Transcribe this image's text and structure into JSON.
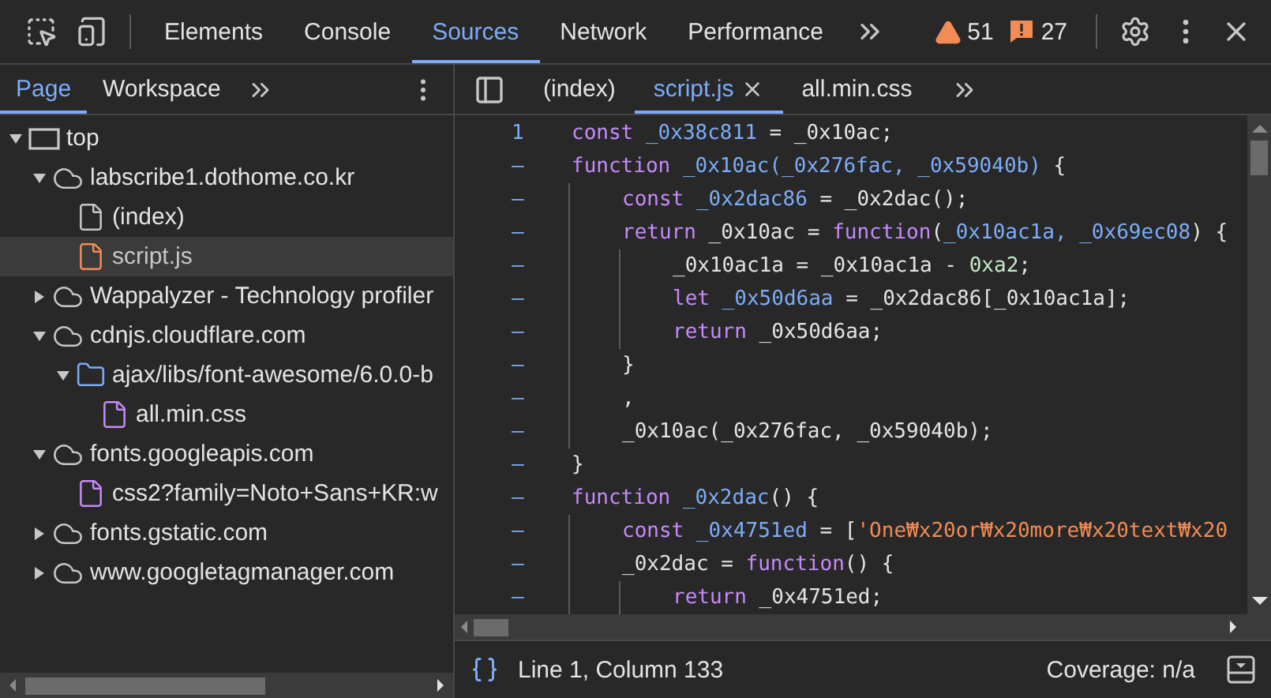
{
  "toolbar": {
    "tabs": [
      {
        "label": "Elements",
        "selected": false
      },
      {
        "label": "Console",
        "selected": false
      },
      {
        "label": "Sources",
        "selected": true
      },
      {
        "label": "Network",
        "selected": false
      },
      {
        "label": "Performance",
        "selected": false
      }
    ],
    "warnings": "51",
    "errors": "27"
  },
  "navigator": {
    "tabs": [
      {
        "label": "Page",
        "selected": true
      },
      {
        "label": "Workspace",
        "selected": false
      }
    ],
    "tree": [
      {
        "kind": "frame",
        "label": "top",
        "expanded": true,
        "selected": false,
        "children": [
          {
            "kind": "domain",
            "label": "labscribe1.dothome.co.kr",
            "expanded": true,
            "selected": false,
            "children": [
              {
                "kind": "file",
                "label": "(index)",
                "color": "#c4c7c5",
                "selected": false
              },
              {
                "kind": "file",
                "label": "script.js",
                "color": "#f28b54",
                "selected": true
              }
            ]
          },
          {
            "kind": "domain",
            "label": "Wappalyzer - Technology profiler",
            "expanded": false,
            "selected": false
          },
          {
            "kind": "domain",
            "label": "cdnjs.cloudflare.com",
            "expanded": true,
            "selected": false,
            "children": [
              {
                "kind": "folder",
                "label": "ajax/libs/font-awesome/6.0.0-b",
                "expanded": true,
                "selected": false,
                "children": [
                  {
                    "kind": "file",
                    "label": "all.min.css",
                    "color": "#c58af9",
                    "selected": false
                  }
                ]
              }
            ]
          },
          {
            "kind": "domain",
            "label": "fonts.googleapis.com",
            "expanded": true,
            "selected": false,
            "children": [
              {
                "kind": "file",
                "label": "css2?family=Noto+Sans+KR:w",
                "color": "#c58af9",
                "selected": false
              }
            ]
          },
          {
            "kind": "domain",
            "label": "fonts.gstatic.com",
            "expanded": false,
            "selected": false
          },
          {
            "kind": "domain",
            "label": "www.googletagmanager.com",
            "expanded": false,
            "selected": false
          }
        ]
      }
    ]
  },
  "editor": {
    "tabs": [
      {
        "label": "(index)",
        "selected": false,
        "closable": false
      },
      {
        "label": "script.js",
        "selected": true,
        "closable": true
      },
      {
        "label": "all.min.css",
        "selected": false,
        "closable": false
      }
    ],
    "lines": [
      {
        "gutter": "1",
        "tokens": [
          {
            "kind": "keyword",
            "text": "const"
          },
          {
            "kind": "name",
            "text": " _0x38c811"
          },
          {
            "kind": "plain",
            "text": " = _0x10ac;"
          }
        ]
      },
      {
        "gutter": "–",
        "tokens": [
          {
            "kind": "keyword",
            "text": "function"
          },
          {
            "kind": "name",
            "text": " _0x10ac(_0x276fac, _0x59040b)"
          },
          {
            "kind": "plain",
            "text": " {"
          }
        ],
        "children": [
          {
            "gutter": "–",
            "tokens": [
              {
                "kind": "keyword",
                "text": "const"
              },
              {
                "kind": "name",
                "text": " _0x2dac86"
              },
              {
                "kind": "plain",
                "text": " = _0x2dac();"
              }
            ]
          },
          {
            "gutter": "–",
            "tokens": [
              {
                "kind": "keyword",
                "text": "return"
              },
              {
                "kind": "plain",
                "text": " _0x10ac = "
              },
              {
                "kind": "keyword",
                "text": "function"
              },
              {
                "kind": "plain",
                "text": "("
              },
              {
                "kind": "name",
                "text": "_0x10ac1a, _0x69ec08"
              },
              {
                "kind": "plain",
                "text": ") {"
              }
            ],
            "children": [
              {
                "gutter": "–",
                "tokens": [
                  {
                    "kind": "plain",
                    "text": "_0x10ac1a = _0x10ac1a - "
                  },
                  {
                    "kind": "number",
                    "text": "0xa2"
                  },
                  {
                    "kind": "plain",
                    "text": ";"
                  }
                ]
              },
              {
                "gutter": "–",
                "tokens": [
                  {
                    "kind": "keyword",
                    "text": "let"
                  },
                  {
                    "kind": "name",
                    "text": " _0x50d6aa"
                  },
                  {
                    "kind": "plain",
                    "text": " = _0x2dac86[_0x10ac1a];"
                  }
                ]
              },
              {
                "gutter": "–",
                "tokens": [
                  {
                    "kind": "keyword",
                    "text": "return"
                  },
                  {
                    "kind": "plain",
                    "text": " _0x50d6aa;"
                  }
                ]
              }
            ]
          },
          {
            "gutter": "–",
            "tokens": [
              {
                "kind": "plain",
                "text": "}"
              }
            ]
          },
          {
            "gutter": "–",
            "tokens": [
              {
                "kind": "plain",
                "text": ","
              }
            ]
          },
          {
            "gutter": "–",
            "tokens": [
              {
                "kind": "plain",
                "text": "_0x10ac(_0x276fac, _0x59040b);"
              }
            ]
          }
        ]
      },
      {
        "gutter": "–",
        "tokens": [
          {
            "kind": "plain",
            "text": "}"
          }
        ]
      },
      {
        "gutter": "–",
        "tokens": [
          {
            "kind": "keyword",
            "text": "function"
          },
          {
            "kind": "name",
            "text": " _0x2dac"
          },
          {
            "kind": "plain",
            "text": "() {"
          }
        ],
        "children": [
          {
            "gutter": "–",
            "tokens": [
              {
                "kind": "keyword",
                "text": "const"
              },
              {
                "kind": "name",
                "text": " _0x4751ed"
              },
              {
                "kind": "plain",
                "text": " = ["
              },
              {
                "kind": "string",
                "text": "'One₩x20or₩x20more₩x20text₩x20"
              }
            ]
          },
          {
            "gutter": "–",
            "tokens": [
              {
                "kind": "plain",
                "text": "_0x2dac = "
              },
              {
                "kind": "keyword",
                "text": "function"
              },
              {
                "kind": "plain",
                "text": "() {"
              }
            ],
            "children": [
              {
                "gutter": "–",
                "tokens": [
                  {
                    "kind": "keyword",
                    "text": "return"
                  },
                  {
                    "kind": "plain",
                    "text": " _0x4751ed;"
                  }
                ]
              }
            ]
          }
        ]
      }
    ]
  },
  "status_bar": {
    "position": "Line 1, Column 133",
    "coverage": "Coverage: n/a"
  }
}
